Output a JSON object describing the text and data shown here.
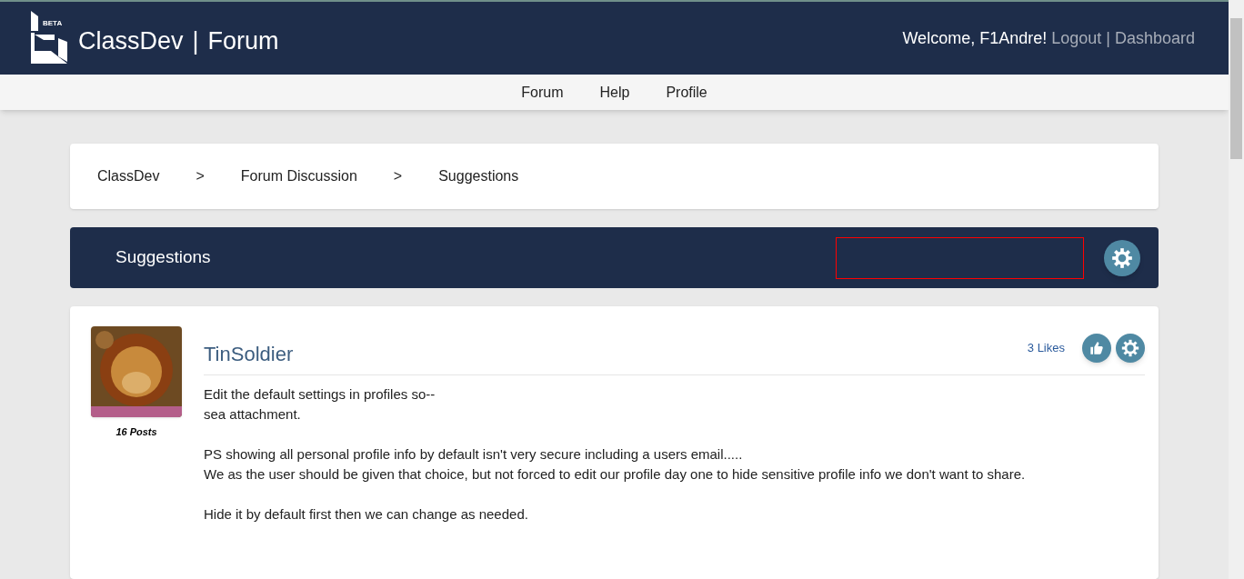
{
  "header": {
    "logo_badge": "BETA",
    "brand": "ClassDev",
    "separator": "|",
    "section": "Forum",
    "welcome": "Welcome, F1Andre!",
    "links": [
      "Logout",
      "Dashboard"
    ],
    "link_separator": "|"
  },
  "nav": [
    "Forum",
    "Help",
    "Profile"
  ],
  "breadcrumb": {
    "items": [
      "ClassDev",
      "Forum Discussion",
      "Suggestions"
    ],
    "separator": ">"
  },
  "category": {
    "title": "Suggestions"
  },
  "post": {
    "author": "TinSoldier",
    "post_count": "16 Posts",
    "likes": "3 Likes",
    "paragraphs": [
      [
        "Edit the default settings in profiles so--",
        "sea attachment."
      ],
      [
        "PS showing all personal profile info by default isn't very secure including a users email.....",
        "We as the user should be given that choice, but not forced to edit our profile day one to hide sensitive profile info we don't want to share."
      ],
      [
        "Hide it by default first then we can change as needed."
      ]
    ]
  }
}
